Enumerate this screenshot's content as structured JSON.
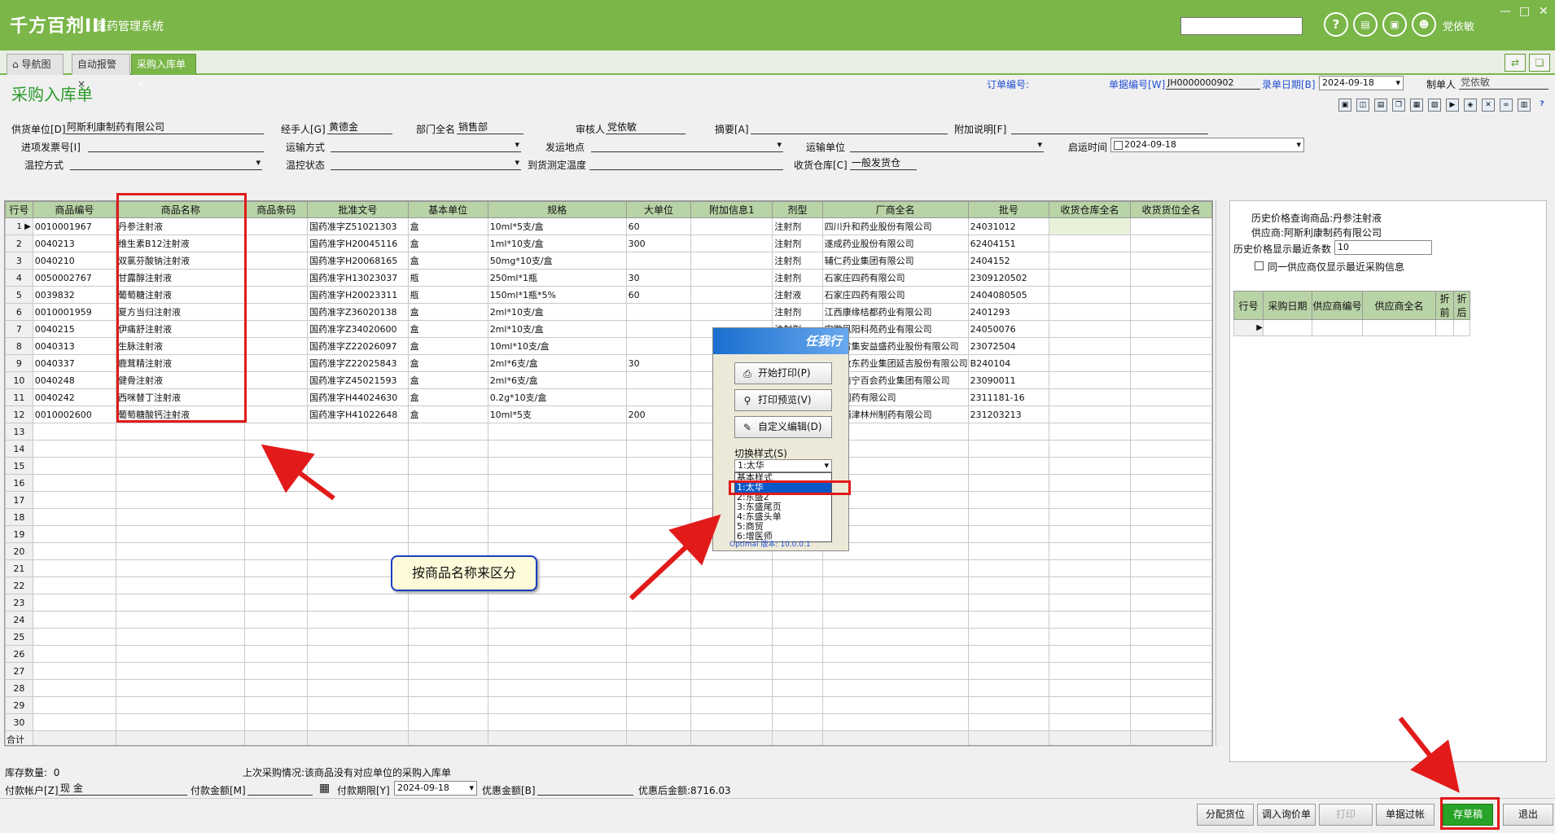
{
  "app": {
    "logo": "千方百剂III",
    "system_name": "医药管理系统",
    "user": "党依敏"
  },
  "tabs": [
    {
      "label": "导航图"
    },
    {
      "label": "自动报警"
    },
    {
      "label": "采购入库单"
    }
  ],
  "form": {
    "title": "采购入库单",
    "order_no_label": "订单编号:",
    "doc_no_label": "单据编号[W]",
    "doc_no": "JH0000000902",
    "entry_date_label": "录单日期[B]",
    "entry_date": "2024-09-18",
    "maker_label": "制单人",
    "maker": "党依敏",
    "supplier_label": "供货单位[D]",
    "supplier": "阿斯利康制药有限公司",
    "handler_label": "经手人[G]",
    "handler": "黄德金",
    "dept_label": "部门全名",
    "dept": "销售部",
    "reviewer_label": "审核人",
    "reviewer": "党依敏",
    "summary_label": "摘要[A]",
    "note_label": "附加说明[F]",
    "invoice_label": "进项发票号[I]",
    "transport_label": "运输方式",
    "ship_from_label": "发运地点",
    "carrier_label": "运输单位",
    "ship_time_label": "启运时间",
    "ship_time": "2024-09-18",
    "temp_ctrl_label": "温控方式",
    "temp_state_label": "温控状态",
    "arrive_temp_label": "到货测定温度",
    "warehouse_label": "收货仓库[C]",
    "warehouse": "一般发货仓"
  },
  "grid": {
    "columns": [
      "行号",
      "商品编号",
      "商品名称",
      "商品条码",
      "批准文号",
      "基本单位",
      "规格",
      "大单位",
      "附加信息1",
      "剂型",
      "厂商全名",
      "批号",
      "收货仓库全名",
      "收货货位全名"
    ],
    "rows": [
      [
        "1",
        "0010001967",
        "丹参注射液",
        "",
        "国药准字Z51021303",
        "盒",
        "10ml*5支/盒",
        "60",
        "",
        "注射剂",
        "四川升和药业股份有限公司",
        "24031012",
        "",
        ""
      ],
      [
        "2",
        "0040213",
        "维生素B12注射液",
        "",
        "国药准字H20045116",
        "盒",
        "1ml*10支/盒",
        "300",
        "",
        "注射剂",
        "遂成药业股份有限公司",
        "62404151",
        "",
        ""
      ],
      [
        "3",
        "0040210",
        "双氯芬酸钠注射液",
        "",
        "国药准字H20068165",
        "盒",
        "50mg*10支/盒",
        "",
        "",
        "注射剂",
        "辅仁药业集团有限公司",
        "2404152",
        "",
        ""
      ],
      [
        "4",
        "0050002767",
        "甘露醇注射液",
        "",
        "国药准字H13023037",
        "瓶",
        "250ml*1瓶",
        "30",
        "",
        "注射剂",
        "石家庄四药有限公司",
        "2309120502",
        "",
        ""
      ],
      [
        "5",
        "0039832",
        "葡萄糖注射液",
        "",
        "国药准字H20023311",
        "瓶",
        "150ml*1瓶*5%",
        "60",
        "",
        "注射液",
        "石家庄四药有限公司",
        "2404080505",
        "",
        ""
      ],
      [
        "6",
        "0010001959",
        "夏方当归注射液",
        "",
        "国药准字Z36020138",
        "盒",
        "2ml*10支/盒",
        "",
        "",
        "注射剂",
        "江西康缘桔都药业有限公司",
        "2401293",
        "",
        ""
      ],
      [
        "7",
        "0040215",
        "伊痛舒注射液",
        "",
        "国药准字Z34020600",
        "盒",
        "2ml*10支/盒",
        "",
        "",
        "注射剂",
        "安徽凤阳科苑药业有限公司",
        "24050076",
        "",
        ""
      ],
      [
        "8",
        "0040313",
        "生脉注射液",
        "",
        "国药准字Z22026097",
        "盒",
        "10ml*10支/盒",
        "",
        "",
        "注射剂",
        "吉林省集安益盛药业股份有限公司",
        "23072504",
        "",
        ""
      ],
      [
        "9",
        "0040337",
        "鹿茸精注射液",
        "",
        "国药准字Z22025843",
        "盒",
        "2ml*6支/盒",
        "30",
        "",
        "注射剂",
        "吉林敖东药业集团延吉股份有限公司",
        "B240104",
        "",
        ""
      ],
      [
        "10",
        "0040248",
        "健骨注射液",
        "",
        "国药准字Z45021593",
        "盒",
        "2ml*6支/盒",
        "",
        "",
        "注射剂",
        "广西南宁百会药业集团有限公司",
        "23090011",
        "",
        ""
      ],
      [
        "11",
        "0040242",
        "西咪替丁注射液",
        "",
        "国药准字H44024630",
        "盒",
        "0.2g*10支/盒",
        "",
        "",
        "注射剂",
        "海南国药有限公司",
        "2311181-16",
        "",
        ""
      ],
      [
        "12",
        "0010002600",
        "葡萄糖酸钙注射液",
        "",
        "国药准字H41022648",
        "盒",
        "10ml*5支",
        "200",
        "",
        "注射剂",
        "河南浦津林州制药有限公司",
        "231203213",
        "",
        ""
      ]
    ],
    "empty_rows": [
      "13",
      "14",
      "15",
      "16",
      "17",
      "18",
      "19",
      "20",
      "21",
      "22",
      "23",
      "24",
      "25",
      "26",
      "27",
      "28",
      "29",
      "30"
    ],
    "total_label": "合计"
  },
  "history": {
    "query_label": "历史价格查询商品:",
    "query_product": "丹参注射液",
    "supplier_label": "供应商:",
    "supplier": "阿斯利康制药有限公司",
    "recent_label": "历史价格显示最近条数",
    "recent_count": "10",
    "same_supplier_label": "同一供应商仅显示最近采购信息",
    "columns": [
      "行号",
      "采购日期",
      "供应商编号",
      "供应商全名",
      "折前",
      "折后"
    ]
  },
  "footer": {
    "stock_label": "库存数量:",
    "stock_value": "0",
    "last_purchase": "上次采购情况:该商品没有对应单位的采购入库单",
    "pay_account_label": "付款帐户[Z]",
    "pay_account": "现 金",
    "pay_amount_label": "付款金额[M]",
    "pay_due_label": "付款期限[Y]",
    "pay_due": "2024-09-18",
    "discount_label": "优惠金额[B]",
    "after_discount_label": "优惠后金额:",
    "after_discount": "8716.03"
  },
  "buttons": {
    "assign": "分配货位",
    "import": "调入询价单",
    "print": "打印",
    "filter": "单据过帐",
    "save_draft": "存草稿",
    "exit": "退出"
  },
  "print_dialog": {
    "brand": "任我行",
    "start_print": "开始打印(P)",
    "preview": "打印预览(V)",
    "custom_edit": "自定义编辑(D)",
    "style_label": "切换样式(S)",
    "style_value": "1:太华",
    "style_options": [
      "基本样式",
      "1:太华",
      "2:东盛2",
      "3:东盛尾页",
      "4:东盛头单",
      "5:商贸",
      "6:增医师"
    ],
    "version": "Optimal 版本: 10.0.0.1"
  },
  "annotation": {
    "callout": "按商品名称来区分"
  }
}
